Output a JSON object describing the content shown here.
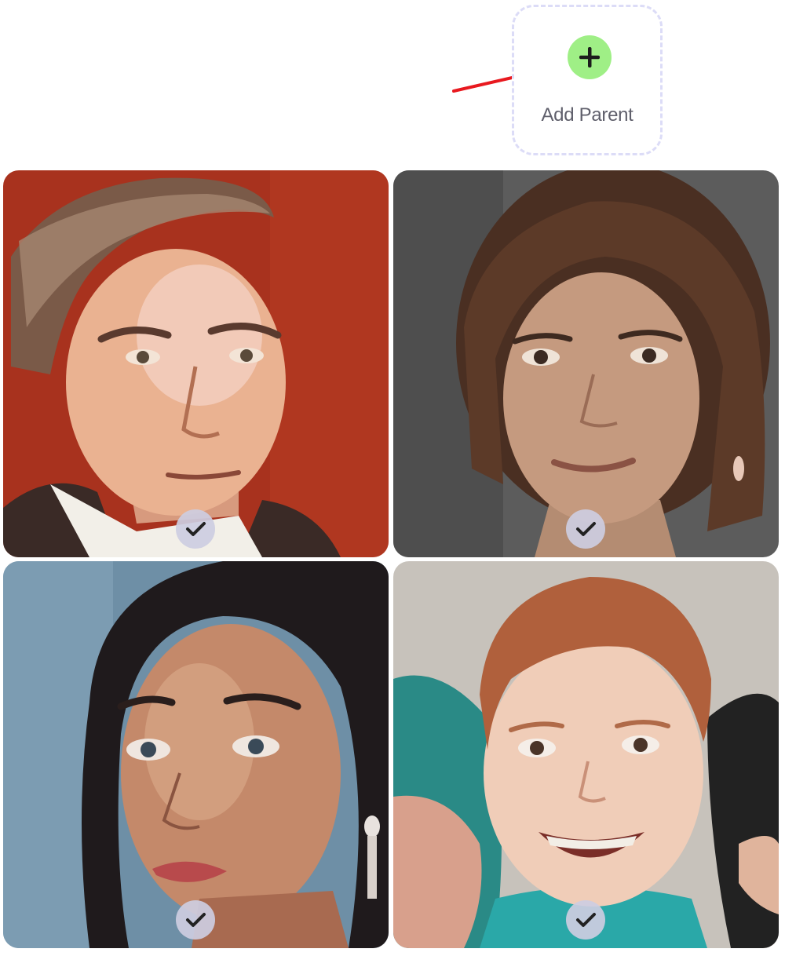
{
  "add_parent": {
    "label": "Add Parent",
    "icon": "plus-icon",
    "accent": "#9fef86"
  },
  "annotation": {
    "icon": "red-arrow-icon",
    "color": "#e8191f"
  },
  "tiles": [
    {
      "name": "tile-man-painted",
      "check_icon": "check-icon",
      "background": "#a8321e"
    },
    {
      "name": "tile-woman-curly",
      "check_icon": "check-icon",
      "background": "#5c5c5c"
    },
    {
      "name": "tile-woman-dark-hair",
      "check_icon": "check-icon",
      "background": "#6e8fa6"
    },
    {
      "name": "tile-child",
      "check_icon": "check-icon",
      "background": "#c7c2bb"
    }
  ]
}
